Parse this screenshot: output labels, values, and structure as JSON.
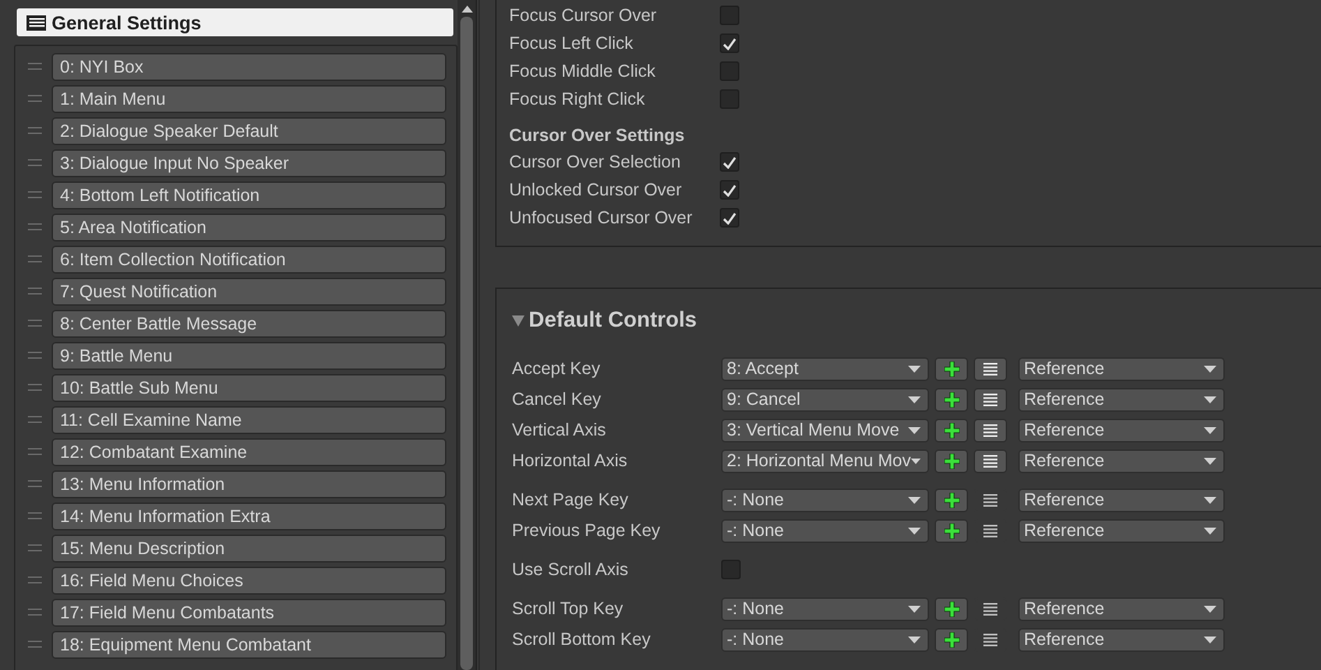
{
  "sidebar": {
    "title": "General Settings",
    "items": [
      {
        "label": "0: NYI Box"
      },
      {
        "label": "1: Main Menu"
      },
      {
        "label": "2: Dialogue Speaker Default"
      },
      {
        "label": "3: Dialogue Input No Speaker"
      },
      {
        "label": "4: Bottom Left Notification"
      },
      {
        "label": "5: Area Notification"
      },
      {
        "label": "6: Item Collection Notification"
      },
      {
        "label": "7: Quest Notification"
      },
      {
        "label": "8: Center Battle Message"
      },
      {
        "label": "9: Battle Menu"
      },
      {
        "label": "10: Battle Sub Menu"
      },
      {
        "label": "11: Cell Examine Name"
      },
      {
        "label": "12: Combatant Examine"
      },
      {
        "label": "13: Menu Information"
      },
      {
        "label": "14: Menu Information Extra"
      },
      {
        "label": "15: Menu Description"
      },
      {
        "label": "16: Field Menu Choices"
      },
      {
        "label": "17: Field Menu Combatants"
      },
      {
        "label": "18: Equipment Menu Combatant"
      }
    ]
  },
  "focus_settings": [
    {
      "kind": "toggle",
      "label": "Focus Cursor Over",
      "checked": false
    },
    {
      "kind": "toggle",
      "label": "Focus Left Click",
      "checked": true
    },
    {
      "kind": "toggle",
      "label": "Focus Middle Click",
      "checked": false
    },
    {
      "kind": "toggle",
      "label": "Focus Right Click",
      "checked": false
    },
    {
      "kind": "heading",
      "label": "Cursor Over Settings"
    },
    {
      "kind": "toggle",
      "label": "Cursor Over Selection",
      "checked": true
    },
    {
      "kind": "toggle",
      "label": "Unlocked Cursor Over",
      "checked": true
    },
    {
      "kind": "toggle",
      "label": "Unfocused Cursor Over",
      "checked": true
    }
  ],
  "default_controls": {
    "title": "Default Controls",
    "expanded": true,
    "rows": [
      {
        "kind": "key",
        "label": "Accept Key",
        "value": "8: Accept",
        "list_active": true,
        "source": "Reference"
      },
      {
        "kind": "key",
        "label": "Cancel Key",
        "value": "9: Cancel",
        "list_active": true,
        "source": "Reference"
      },
      {
        "kind": "key",
        "label": "Vertical Axis",
        "value": "3: Vertical Menu Move",
        "list_active": true,
        "source": "Reference"
      },
      {
        "kind": "key",
        "label": "Horizontal Axis",
        "value": "2: Horizontal Menu Mov",
        "list_active": true,
        "source": "Reference"
      },
      {
        "kind": "spacer"
      },
      {
        "kind": "key",
        "label": "Next Page Key",
        "value": "-: None",
        "list_active": false,
        "source": "Reference"
      },
      {
        "kind": "key",
        "label": "Previous Page Key",
        "value": "-: None",
        "list_active": false,
        "source": "Reference"
      },
      {
        "kind": "spacer"
      },
      {
        "kind": "toggle",
        "label": "Use Scroll Axis",
        "checked": false
      },
      {
        "kind": "spacer"
      },
      {
        "kind": "key",
        "label": "Scroll Top Key",
        "value": "-: None",
        "list_active": false,
        "source": "Reference"
      },
      {
        "kind": "key",
        "label": "Scroll Bottom Key",
        "value": "-: None",
        "list_active": false,
        "source": "Reference"
      }
    ]
  }
}
